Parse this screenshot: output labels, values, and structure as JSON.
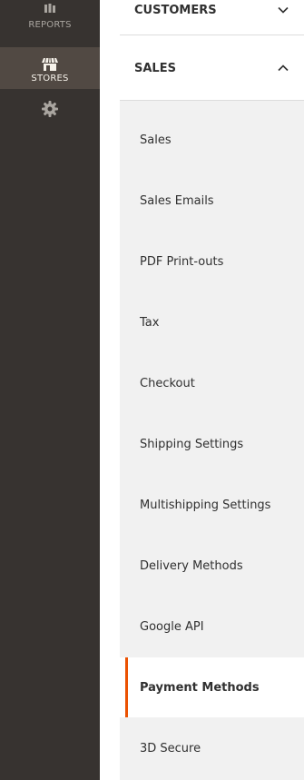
{
  "sidebar": {
    "items": [
      {
        "label": "REPORTS",
        "icon": "reports-icon"
      },
      {
        "label": "STORES",
        "icon": "store-icon",
        "active": true
      },
      {
        "label": "",
        "icon": "gear-icon"
      }
    ]
  },
  "panel": {
    "customers": {
      "label": "CUSTOMERS",
      "icon": "chevron-down-icon"
    },
    "sales": {
      "label": "SALES",
      "icon": "chevron-up-icon",
      "items": [
        {
          "label": "Sales"
        },
        {
          "label": "Sales Emails"
        },
        {
          "label": "PDF Print-outs"
        },
        {
          "label": "Tax"
        },
        {
          "label": "Checkout"
        },
        {
          "label": "Shipping Settings"
        },
        {
          "label": "Multishipping Settings"
        },
        {
          "label": "Delivery Methods"
        },
        {
          "label": "Google API"
        },
        {
          "label": "Payment Methods",
          "active": true
        },
        {
          "label": "3D Secure"
        }
      ]
    }
  },
  "colors": {
    "sidebar_bg": "#373330",
    "sidebar_active_bg": "#514943",
    "submenu_bg": "#f1f1f1",
    "active_accent": "#eb5202"
  }
}
